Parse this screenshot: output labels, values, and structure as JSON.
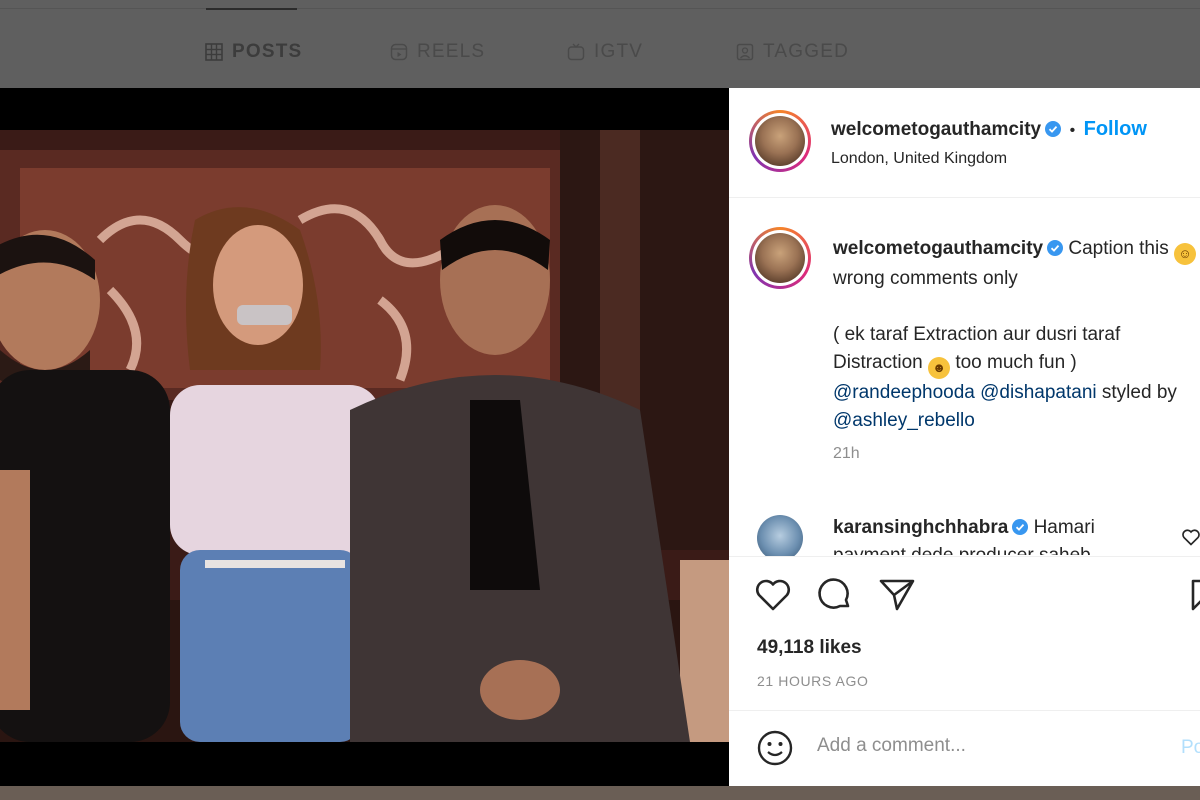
{
  "tabs": [
    {
      "label": "POSTS",
      "icon": "grid-icon"
    },
    {
      "label": "REELS",
      "icon": "reels-icon"
    },
    {
      "label": "IGTV",
      "icon": "igtv-icon"
    },
    {
      "label": "TAGGED",
      "icon": "tagged-icon"
    }
  ],
  "post": {
    "username": "welcometogauthamcity",
    "follow_label": "Follow",
    "separator": "•",
    "location": "London, United Kingdom",
    "caption_part1": "Caption this",
    "caption_part2": "wrong comments only",
    "caption_line2a": "( ek taraf Extraction aur dusri taraf Distraction",
    "caption_line2b": "too much fun )",
    "mention1": "@randeephooda",
    "mention2": "@dishapatani",
    "styled_text": "styled by",
    "mention3": "@ashley_rebello",
    "caption_time": "21h",
    "comment_user": "karansinghchhabra",
    "comment_text": "Hamari",
    "comment_text2": "payment dede producer saheb",
    "likes": "49,118 likes",
    "time_ago": "21 HOURS AGO",
    "comment_placeholder": "Add a comment...",
    "post_label": "Post"
  },
  "colors": {
    "link": "#0095f6",
    "mention": "#00376b",
    "muted": "#8e8e8e"
  }
}
